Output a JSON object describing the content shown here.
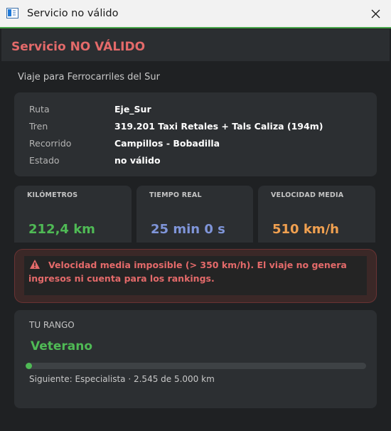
{
  "window": {
    "title": "Servicio no válido"
  },
  "heading": "Servicio NO VÁLIDO",
  "subtitle": "Viaje para Ferrocarriles del Sur",
  "details": [
    {
      "label": "Ruta",
      "value": "Eje_Sur"
    },
    {
      "label": "Tren",
      "value": "319.201 Taxi Retales + Tals Caliza (194m)"
    },
    {
      "label": "Recorrido",
      "value": "Campillos - Bobadilla"
    },
    {
      "label": "Estado",
      "value": "no válido"
    }
  ],
  "stats": [
    {
      "label": "KILÓMETROS",
      "value": "212,4 km",
      "color": "#4fba55"
    },
    {
      "label": "TIEMPO REAL",
      "value": "25 min 0 s",
      "color": "#7f95d9"
    },
    {
      "label": "VELOCIDAD MEDIA",
      "value": "510 km/h",
      "color": "#f0a050"
    }
  ],
  "warning": {
    "icon": "warning-triangle-icon",
    "text": "Velocidad media imposible (> 350 km/h). El viaje no genera ingresos ni cuenta para los rankings."
  },
  "rank": {
    "label": "TU RANGO",
    "name": "Veterano",
    "progress_fraction": 0.0,
    "next": "Siguiente: Especialista  ·  2.545 de 5.000 km"
  },
  "colors": {
    "accent": "#47a54b",
    "error": "#e46a6a",
    "background": "#1f2123",
    "card": "#2c2f32"
  }
}
